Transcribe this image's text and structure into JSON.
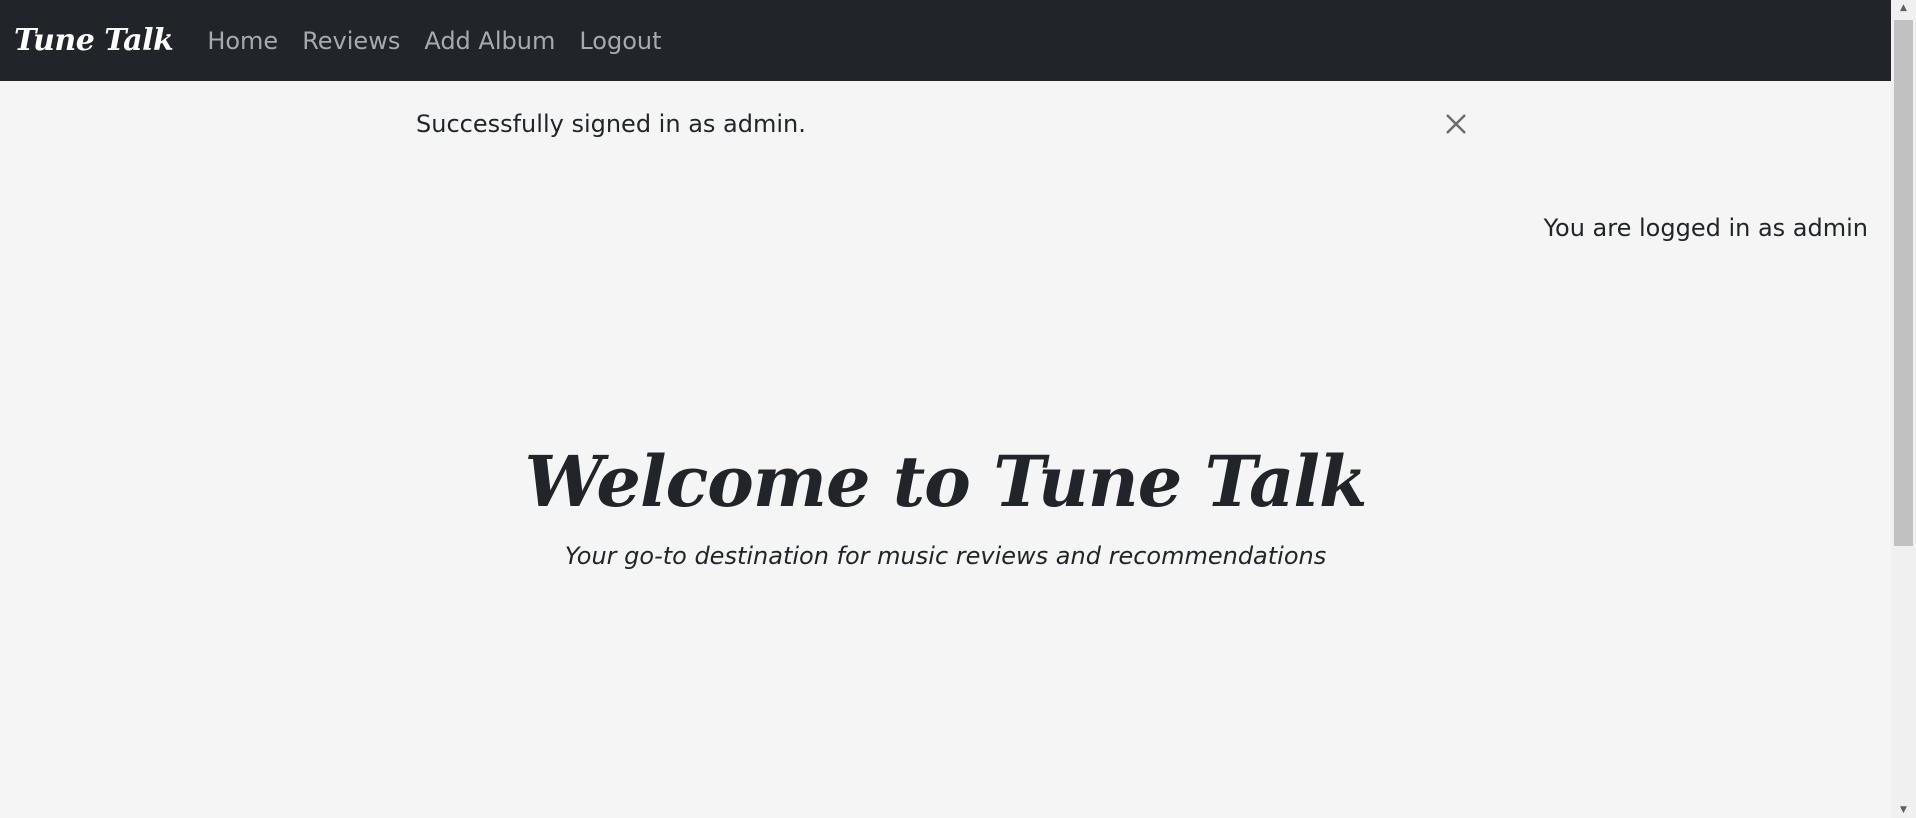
{
  "navbar": {
    "brand": "Tune Talk",
    "links": [
      "Home",
      "Reviews",
      "Add Album",
      "Logout"
    ]
  },
  "alert": {
    "message": "Successfully signed in as admin.",
    "close_icon": "close-icon"
  },
  "status": {
    "logged_in_text": "You are logged in as admin"
  },
  "hero": {
    "title": "Welcome to Tune Talk",
    "subtitle": "Your go-to destination for music reviews and recommendations"
  },
  "colors": {
    "navbar_bg": "#212529",
    "page_bg": "#f5f5f5",
    "nav_link": "#a6a9ad",
    "text": "#212529"
  }
}
